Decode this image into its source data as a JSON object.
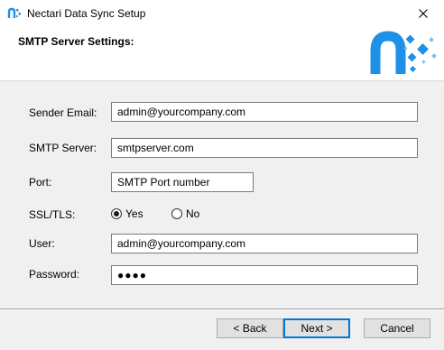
{
  "window": {
    "title": "Nectari Data Sync Setup"
  },
  "header": {
    "title": "SMTP Server Settings:"
  },
  "form": {
    "sender_email": {
      "label": "Sender Email:",
      "value": "admin@yourcompany.com"
    },
    "smtp_server": {
      "label": "SMTP Server:",
      "value": "smtpserver.com"
    },
    "port": {
      "label": "Port:",
      "value": "SMTP Port number"
    },
    "ssl_tls": {
      "label": "SSL/TLS:",
      "options": [
        {
          "label": "Yes",
          "checked": true
        },
        {
          "label": "No",
          "checked": false
        }
      ]
    },
    "user": {
      "label": "User:",
      "value": "admin@yourcompany.com"
    },
    "password": {
      "label": "Password:",
      "value": "●●●●"
    }
  },
  "buttons": {
    "back": "< Back",
    "next": "Next >",
    "cancel": "Cancel"
  },
  "colors": {
    "brand_blue": "#1e90e6",
    "focus_border": "#0078d7"
  },
  "icons": {
    "app": "nectari-logo-icon",
    "close": "close-icon"
  }
}
